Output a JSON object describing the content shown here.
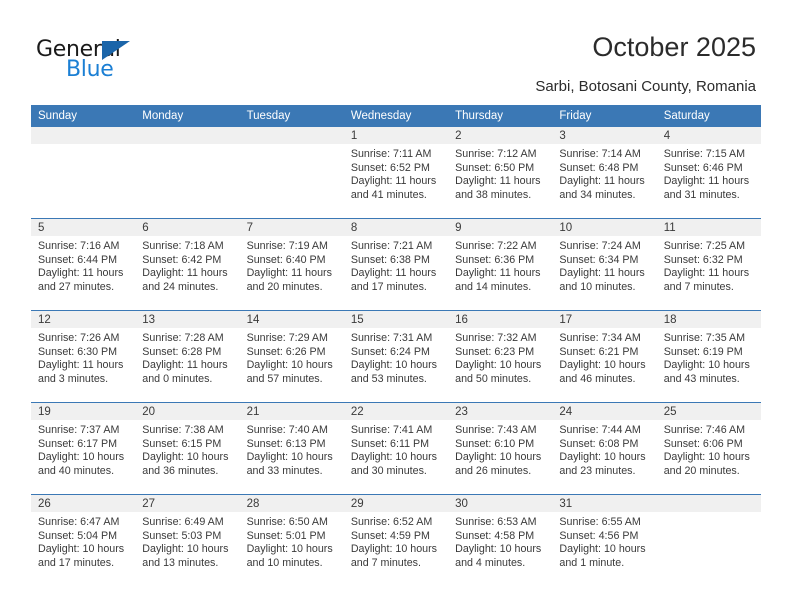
{
  "brand": {
    "name_part1": "General",
    "name_part2": "Blue",
    "triangle_color": "#1b65a9",
    "blue_color": "#1b7fd4"
  },
  "header": {
    "title": "October 2025",
    "subtitle": "Sarbi, Botosani County, Romania"
  },
  "theme": {
    "header_bg": "#3b78b5",
    "daynum_bg": "#f0f0f0",
    "text": "#3a3a3a"
  },
  "weekday_headers": [
    "Sunday",
    "Monday",
    "Tuesday",
    "Wednesday",
    "Thursday",
    "Friday",
    "Saturday"
  ],
  "labels": {
    "sunrise_prefix": "Sunrise:",
    "sunset_prefix": "Sunset:",
    "daylight_prefix": "Daylight:"
  },
  "weeks": [
    [
      {
        "day": "",
        "empty": true
      },
      {
        "day": "",
        "empty": true
      },
      {
        "day": "",
        "empty": true
      },
      {
        "day": "1",
        "sunrise": "Sunrise: 7:11 AM",
        "sunset": "Sunset: 6:52 PM",
        "daylight": "Daylight: 11 hours and 41 minutes."
      },
      {
        "day": "2",
        "sunrise": "Sunrise: 7:12 AM",
        "sunset": "Sunset: 6:50 PM",
        "daylight": "Daylight: 11 hours and 38 minutes."
      },
      {
        "day": "3",
        "sunrise": "Sunrise: 7:14 AM",
        "sunset": "Sunset: 6:48 PM",
        "daylight": "Daylight: 11 hours and 34 minutes."
      },
      {
        "day": "4",
        "sunrise": "Sunrise: 7:15 AM",
        "sunset": "Sunset: 6:46 PM",
        "daylight": "Daylight: 11 hours and 31 minutes."
      }
    ],
    [
      {
        "day": "5",
        "sunrise": "Sunrise: 7:16 AM",
        "sunset": "Sunset: 6:44 PM",
        "daylight": "Daylight: 11 hours and 27 minutes."
      },
      {
        "day": "6",
        "sunrise": "Sunrise: 7:18 AM",
        "sunset": "Sunset: 6:42 PM",
        "daylight": "Daylight: 11 hours and 24 minutes."
      },
      {
        "day": "7",
        "sunrise": "Sunrise: 7:19 AM",
        "sunset": "Sunset: 6:40 PM",
        "daylight": "Daylight: 11 hours and 20 minutes."
      },
      {
        "day": "8",
        "sunrise": "Sunrise: 7:21 AM",
        "sunset": "Sunset: 6:38 PM",
        "daylight": "Daylight: 11 hours and 17 minutes."
      },
      {
        "day": "9",
        "sunrise": "Sunrise: 7:22 AM",
        "sunset": "Sunset: 6:36 PM",
        "daylight": "Daylight: 11 hours and 14 minutes."
      },
      {
        "day": "10",
        "sunrise": "Sunrise: 7:24 AM",
        "sunset": "Sunset: 6:34 PM",
        "daylight": "Daylight: 11 hours and 10 minutes."
      },
      {
        "day": "11",
        "sunrise": "Sunrise: 7:25 AM",
        "sunset": "Sunset: 6:32 PM",
        "daylight": "Daylight: 11 hours and 7 minutes."
      }
    ],
    [
      {
        "day": "12",
        "sunrise": "Sunrise: 7:26 AM",
        "sunset": "Sunset: 6:30 PM",
        "daylight": "Daylight: 11 hours and 3 minutes."
      },
      {
        "day": "13",
        "sunrise": "Sunrise: 7:28 AM",
        "sunset": "Sunset: 6:28 PM",
        "daylight": "Daylight: 11 hours and 0 minutes."
      },
      {
        "day": "14",
        "sunrise": "Sunrise: 7:29 AM",
        "sunset": "Sunset: 6:26 PM",
        "daylight": "Daylight: 10 hours and 57 minutes."
      },
      {
        "day": "15",
        "sunrise": "Sunrise: 7:31 AM",
        "sunset": "Sunset: 6:24 PM",
        "daylight": "Daylight: 10 hours and 53 minutes."
      },
      {
        "day": "16",
        "sunrise": "Sunrise: 7:32 AM",
        "sunset": "Sunset: 6:23 PM",
        "daylight": "Daylight: 10 hours and 50 minutes."
      },
      {
        "day": "17",
        "sunrise": "Sunrise: 7:34 AM",
        "sunset": "Sunset: 6:21 PM",
        "daylight": "Daylight: 10 hours and 46 minutes."
      },
      {
        "day": "18",
        "sunrise": "Sunrise: 7:35 AM",
        "sunset": "Sunset: 6:19 PM",
        "daylight": "Daylight: 10 hours and 43 minutes."
      }
    ],
    [
      {
        "day": "19",
        "sunrise": "Sunrise: 7:37 AM",
        "sunset": "Sunset: 6:17 PM",
        "daylight": "Daylight: 10 hours and 40 minutes."
      },
      {
        "day": "20",
        "sunrise": "Sunrise: 7:38 AM",
        "sunset": "Sunset: 6:15 PM",
        "daylight": "Daylight: 10 hours and 36 minutes."
      },
      {
        "day": "21",
        "sunrise": "Sunrise: 7:40 AM",
        "sunset": "Sunset: 6:13 PM",
        "daylight": "Daylight: 10 hours and 33 minutes."
      },
      {
        "day": "22",
        "sunrise": "Sunrise: 7:41 AM",
        "sunset": "Sunset: 6:11 PM",
        "daylight": "Daylight: 10 hours and 30 minutes."
      },
      {
        "day": "23",
        "sunrise": "Sunrise: 7:43 AM",
        "sunset": "Sunset: 6:10 PM",
        "daylight": "Daylight: 10 hours and 26 minutes."
      },
      {
        "day": "24",
        "sunrise": "Sunrise: 7:44 AM",
        "sunset": "Sunset: 6:08 PM",
        "daylight": "Daylight: 10 hours and 23 minutes."
      },
      {
        "day": "25",
        "sunrise": "Sunrise: 7:46 AM",
        "sunset": "Sunset: 6:06 PM",
        "daylight": "Daylight: 10 hours and 20 minutes."
      }
    ],
    [
      {
        "day": "26",
        "sunrise": "Sunrise: 6:47 AM",
        "sunset": "Sunset: 5:04 PM",
        "daylight": "Daylight: 10 hours and 17 minutes."
      },
      {
        "day": "27",
        "sunrise": "Sunrise: 6:49 AM",
        "sunset": "Sunset: 5:03 PM",
        "daylight": "Daylight: 10 hours and 13 minutes."
      },
      {
        "day": "28",
        "sunrise": "Sunrise: 6:50 AM",
        "sunset": "Sunset: 5:01 PM",
        "daylight": "Daylight: 10 hours and 10 minutes."
      },
      {
        "day": "29",
        "sunrise": "Sunrise: 6:52 AM",
        "sunset": "Sunset: 4:59 PM",
        "daylight": "Daylight: 10 hours and 7 minutes."
      },
      {
        "day": "30",
        "sunrise": "Sunrise: 6:53 AM",
        "sunset": "Sunset: 4:58 PM",
        "daylight": "Daylight: 10 hours and 4 minutes."
      },
      {
        "day": "31",
        "sunrise": "Sunrise: 6:55 AM",
        "sunset": "Sunset: 4:56 PM",
        "daylight": "Daylight: 10 hours and 1 minute."
      },
      {
        "day": "",
        "empty": true
      }
    ]
  ]
}
